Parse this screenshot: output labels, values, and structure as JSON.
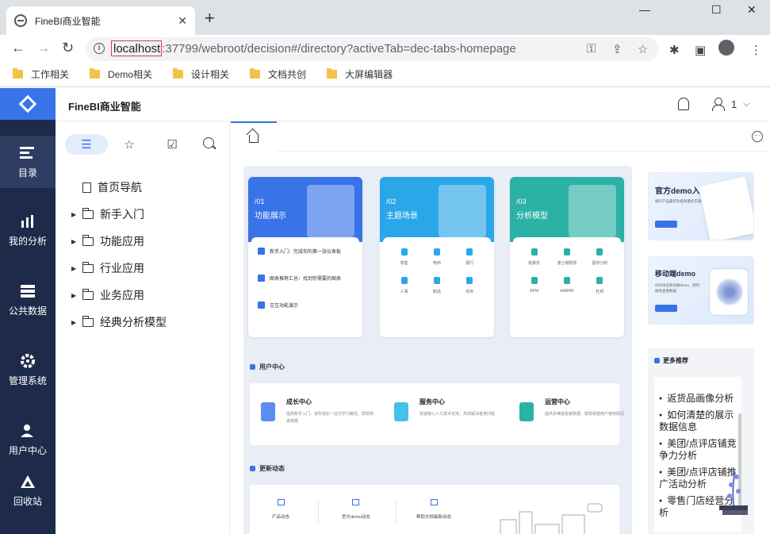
{
  "browser": {
    "tab_title": "FineBI商业智能",
    "tab_close": "✕",
    "new_tab": "+",
    "url_host": "localhost",
    "url_rest": ":37799/webroot/decision#/directory?activeTab=dec-tabs-homepage",
    "bookmarks": [
      "工作相关",
      "Demo相关",
      "设计相关",
      "文档共创",
      "大屏编辑器"
    ]
  },
  "app": {
    "brand": "FineBI商业智能",
    "user_name": "1",
    "rail": [
      "目录",
      "我的分析",
      "公共数据",
      "管理系统",
      "用户中心",
      "回收站"
    ],
    "tree": {
      "home": "首页导航",
      "folders": [
        "新手入门",
        "功能应用",
        "行业应用",
        "业务应用",
        "经典分析模型"
      ]
    }
  },
  "home": {
    "cards": [
      {
        "num": "/01",
        "title": "功能展示",
        "color": "#3873e8",
        "links": [
          "新手入门：完成你的第一张仪表板",
          "图表推荐汇总：找到你需要的图表",
          "交互功能演示"
        ]
      },
      {
        "num": "/02",
        "title": "主题场景",
        "color": "#2aa7e8",
        "items": [
          "零售",
          "电商",
          "银行",
          "人事",
          "制造",
          "财务"
        ]
      },
      {
        "num": "/03",
        "title": "分析模型",
        "color": "#2bb1a5",
        "items": [
          "帕累托",
          "波士顿矩阵",
          "留存分析",
          "RFM",
          "AARRR",
          "杜邦"
        ]
      }
    ],
    "user_center_title": "用户中心",
    "user_center": [
      {
        "title": "成长中心",
        "desc": "提供新手入门、进阶成长一站式学习路径，帮助快速掌握",
        "color": "#5b8ef0"
      },
      {
        "title": "服务中心",
        "desc": "快速接入人工技术支持，高效解决各类问题",
        "color": "#45c0e8"
      },
      {
        "title": "运营中心",
        "desc": "提供多维度看板数据，帮助掌握用户使用情况",
        "color": "#2bb1a5"
      }
    ],
    "news_title": "更新动态",
    "news": [
      "产品动态",
      "官方demo动态",
      "帮助文档最新动态"
    ],
    "promos": [
      {
        "title": "官方demo入口",
        "desc": "展示产品最新功能和最佳实践"
      },
      {
        "title": "移动端demo",
        "desc": "扫码体验移动端demo，随时随地查看数据"
      }
    ],
    "recommend_title": "更多推荐",
    "recommend": [
      "返货品画像分析",
      "如何清楚的展示数据信息",
      "美团/点评店铺竞争力分析",
      "美团/点评店铺推广活动分析",
      "零售门店经营分析"
    ]
  }
}
